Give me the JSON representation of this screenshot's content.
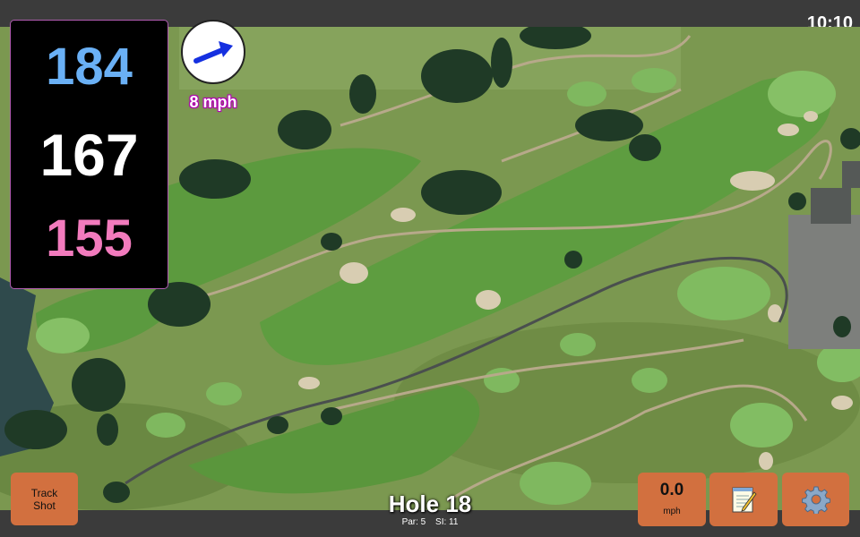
{
  "status": {
    "time": "10:10"
  },
  "distances": {
    "back": "184",
    "middle": "167",
    "front": "155"
  },
  "wind": {
    "speed": "8 mph",
    "icon": "wind-direction-arrow-icon"
  },
  "hole": {
    "title": "Hole 18",
    "par": "Par: 5",
    "stroke_index": "SI: 11"
  },
  "buttons": {
    "track_shot": "Track Shot",
    "speed_value": "0.0",
    "speed_unit": "mph",
    "notes_icon": "notepad-icon",
    "settings_icon": "gear-icon"
  },
  "colors": {
    "back_distance": "#6ab0f5",
    "middle_distance": "#ffffff",
    "front_distance": "#f27bbd",
    "button_bg": "#d2703f",
    "bar_bg": "#3b3b3b"
  }
}
